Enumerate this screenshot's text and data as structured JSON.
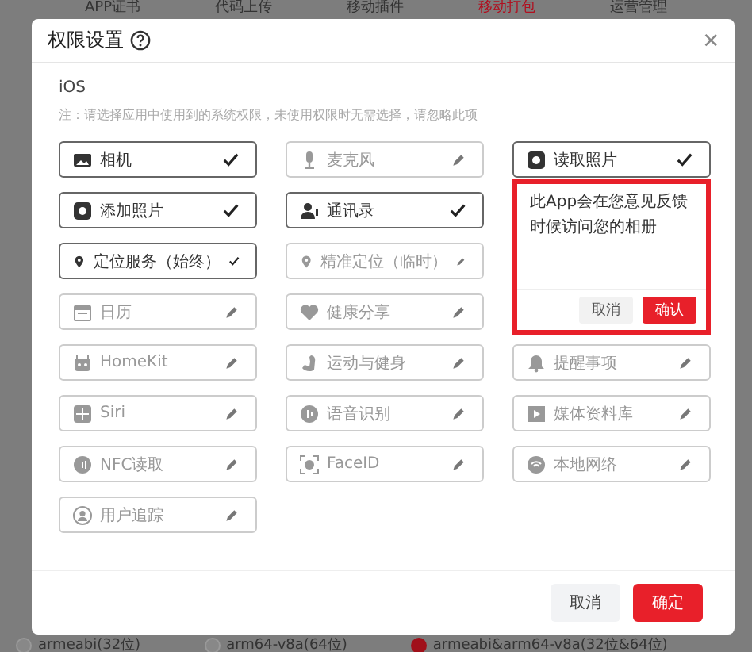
{
  "nav_tabs": [
    {
      "label": "APP证书",
      "selected": false
    },
    {
      "label": "代码上传",
      "selected": false
    },
    {
      "label": "移动插件",
      "selected": false
    },
    {
      "label": "移动打包",
      "selected": true
    },
    {
      "label": "运营管理",
      "selected": false
    }
  ],
  "dialog": {
    "title": "权限设置",
    "close": "×",
    "platform": "iOS",
    "note": "注：请选择应用中使用到的系统权限，未使用权限时无需选择，请忽略此项",
    "permissions": [
      {
        "label": "相机",
        "checked": true
      },
      {
        "label": "麦克风",
        "checked": false
      },
      {
        "label": "读取照片",
        "checked": true
      },
      {
        "label": "添加照片",
        "checked": true
      },
      {
        "label": "通讯录",
        "checked": true
      },
      {
        "label": "定位服务（始终）",
        "checked": true
      },
      {
        "label": "精准定位（临时）",
        "checked": false
      },
      {
        "label": "日历",
        "checked": false
      },
      {
        "label": "健康分享",
        "checked": false
      },
      {
        "label": "HomeKit",
        "checked": false
      },
      {
        "label": "运动与健身",
        "checked": false
      },
      {
        "label": "提醒事项",
        "checked": false
      },
      {
        "label": "Siri",
        "checked": false
      },
      {
        "label": "语音识别",
        "checked": false
      },
      {
        "label": "媒体资料库",
        "checked": false
      },
      {
        "label": "NFC读取",
        "checked": false
      },
      {
        "label": "FaceID",
        "checked": false
      },
      {
        "label": "本地网络",
        "checked": false
      },
      {
        "label": "用户追踪",
        "checked": false
      }
    ],
    "popover": {
      "text": "此App会在您意见反馈时候访问您的相册",
      "highlighted": true,
      "cancel": "取消",
      "confirm": "确认"
    },
    "buttons": {
      "cancel": "取消",
      "ok": "确定"
    }
  },
  "architectures": [
    {
      "label": "armeabi(32位)",
      "selected": false
    },
    {
      "label": "arm64-v8a(64位)",
      "selected": false
    },
    {
      "label": "armeabi&arm64-v8a(32位&64位)",
      "selected": true
    }
  ]
}
